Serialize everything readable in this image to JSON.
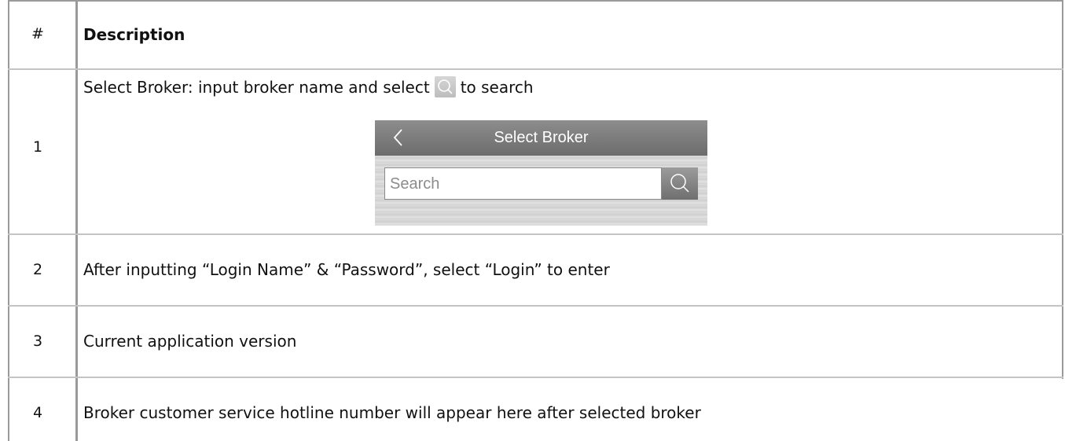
{
  "table": {
    "header": {
      "num": "#",
      "description": "Description"
    },
    "rows": [
      {
        "num": "1",
        "desc_prefix": "Select Broker: input broker name and select",
        "desc_suffix": "to search",
        "icon": "search-icon",
        "mock": {
          "title": "Select Broker",
          "search_placeholder": "Search",
          "back_icon": "chevron-left-icon",
          "search_icon": "search-icon"
        }
      },
      {
        "num": "2",
        "desc": "After inputting “Login Name” & “Password”, select “Login” to enter"
      },
      {
        "num": "3",
        "desc": "Current application version"
      },
      {
        "num": "4",
        "desc": "Broker customer service hotline number will appear here after selected broker"
      }
    ]
  },
  "colors": {
    "grid": "#9a9a9a",
    "row_line": "#c4c4c4",
    "mock_bar": "#7a7a7a"
  }
}
